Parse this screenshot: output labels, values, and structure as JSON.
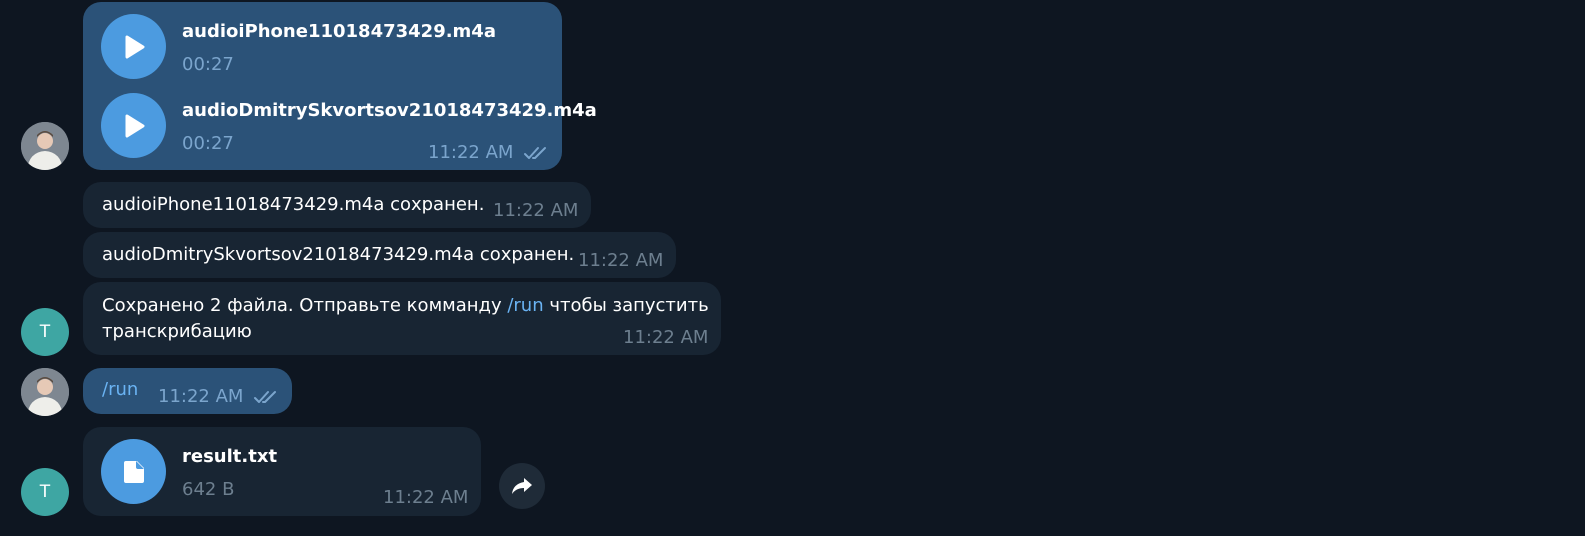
{
  "messages": {
    "audio_group": {
      "files": [
        {
          "name": "audioiPhone11018473429.m4a",
          "duration": "00:27"
        },
        {
          "name": "audioDmitrySkvortsov21018473429.m4a",
          "duration": "00:27"
        }
      ],
      "time": "11:22 AM"
    },
    "saved1": {
      "text": "audioiPhone11018473429.m4a сохранен.",
      "time": "11:22 AM"
    },
    "saved2": {
      "text": "audioDmitrySkvortsov21018473429.m4a сохранен.",
      "time": "11:22 AM"
    },
    "bot_prompt": {
      "line1_before": "Сохранено 2 файла. Отправьте комманду ",
      "command": "/run",
      "line1_after": " чтобы запустить",
      "line2": "транскрибацию",
      "time": "11:22 AM"
    },
    "run_cmd": {
      "text": "/run",
      "time": "11:22 AM"
    },
    "result_file": {
      "name": "result.txt",
      "size": "642 B",
      "time": "11:22 AM"
    }
  },
  "bot_avatar_letter": "T",
  "icons": {
    "play": "play-icon",
    "read_receipt": "double-check-icon",
    "file": "document-icon",
    "forward": "forward-icon"
  },
  "colors": {
    "background": "#0e1621",
    "outgoing_bubble": "#2b5278",
    "incoming_bubble": "#182533",
    "accent": "#4c9be0",
    "link": "#6ab3f3",
    "bot_avatar": "#3ea6a3"
  }
}
